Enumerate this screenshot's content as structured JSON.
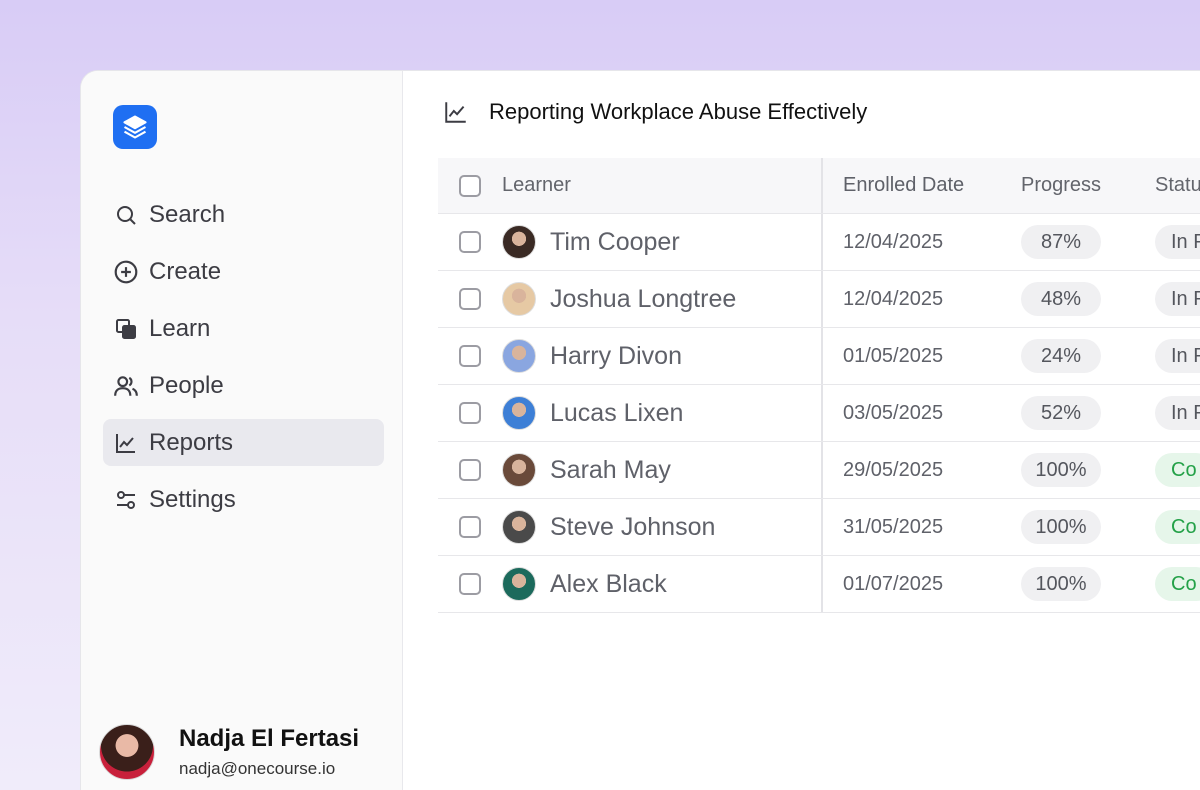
{
  "user": {
    "name": "Nadja El Fertasi",
    "email": "nadja@onecourse.io"
  },
  "nav": [
    {
      "key": "search",
      "label": "Search",
      "icon": "search-icon"
    },
    {
      "key": "create",
      "label": "Create",
      "icon": "plus-circle-icon"
    },
    {
      "key": "learn",
      "label": "Learn",
      "icon": "layers-copy-icon"
    },
    {
      "key": "people",
      "label": "People",
      "icon": "people-icon"
    },
    {
      "key": "reports",
      "label": "Reports",
      "icon": "chart-line-icon",
      "active": true
    },
    {
      "key": "settings",
      "label": "Settings",
      "icon": "sliders-icon"
    }
  ],
  "header": {
    "title": "Reporting Workplace Abuse Effectively",
    "icon": "chart-line-icon"
  },
  "table": {
    "columns": {
      "learner": "Learner",
      "enrolled": "Enrolled Date",
      "progress": "Progress",
      "status": "Statu"
    },
    "rows": [
      {
        "name": "Tim Cooper",
        "date": "12/04/2025",
        "progress": "87%",
        "status": "In P",
        "complete": false,
        "avatar_color": "#3a2a24"
      },
      {
        "name": "Joshua Longtree",
        "date": "12/04/2025",
        "progress": "48%",
        "status": "In P",
        "complete": false,
        "avatar_color": "#e6c9a4"
      },
      {
        "name": "Harry Divon",
        "date": "01/05/2025",
        "progress": "24%",
        "status": "In P",
        "complete": false,
        "avatar_color": "#8aa6e0"
      },
      {
        "name": "Lucas Lixen",
        "date": "03/05/2025",
        "progress": "52%",
        "status": "In P",
        "complete": false,
        "avatar_color": "#3d7fd6"
      },
      {
        "name": "Sarah May",
        "date": "29/05/2025",
        "progress": "100%",
        "status": "Co",
        "complete": true,
        "avatar_color": "#6a4a3a"
      },
      {
        "name": "Steve Johnson",
        "date": "31/05/2025",
        "progress": "100%",
        "status": "Co",
        "complete": true,
        "avatar_color": "#4a4a4a"
      },
      {
        "name": "Alex Black",
        "date": "01/07/2025",
        "progress": "100%",
        "status": "Co",
        "complete": true,
        "avatar_color": "#1c6a5c"
      }
    ]
  },
  "colors": {
    "brand": "#1f6ff2",
    "complete_text": "#24a148",
    "complete_bg": "#e6f6ea"
  }
}
